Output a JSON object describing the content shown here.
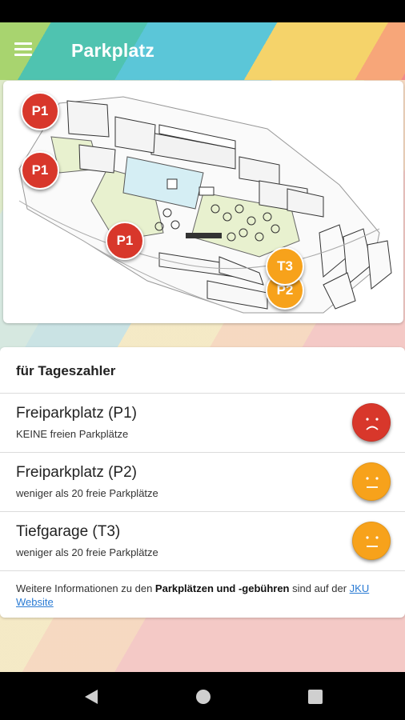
{
  "app_bar": {
    "title": "Parkplatz",
    "menu_icon": "hamburger-menu-icon"
  },
  "map": {
    "markers": [
      {
        "label": "P1",
        "color": "#d8372b"
      },
      {
        "label": "P1",
        "color": "#d8372b"
      },
      {
        "label": "P1",
        "color": "#d8372b"
      },
      {
        "label": "P2",
        "color": "#f7a21b"
      },
      {
        "label": "T3",
        "color": "#f7a21b"
      }
    ]
  },
  "info": {
    "heading": "für Tageszahler",
    "lots": [
      {
        "name": "Freiparkplatz (P1)",
        "status": "KEINE freien Parkplätze",
        "face": "sad-face-icon",
        "color": "#d8372b"
      },
      {
        "name": "Freiparkplatz (P2)",
        "status": "weniger als 20 freie Parkplätze",
        "face": "neutral-face-icon",
        "color": "#f7a21b"
      },
      {
        "name": "Tiefgarage (T3)",
        "status": "weniger als 20 freie Parkplätze",
        "face": "neutral-face-icon",
        "color": "#f7a21b"
      }
    ],
    "footer": {
      "text_before": "Weitere Informationen zu den ",
      "bold": "Parkplätzen und -gebühren",
      "text_after": " sind auf der ",
      "link": "JKU Website"
    }
  },
  "colors": {
    "full": "#d8372b",
    "limited": "#f7a21b",
    "link": "#2a7bd4"
  },
  "nav": {
    "back_icon": "back-triangle-icon",
    "home_icon": "home-circle-icon",
    "recents_icon": "recents-square-icon"
  }
}
